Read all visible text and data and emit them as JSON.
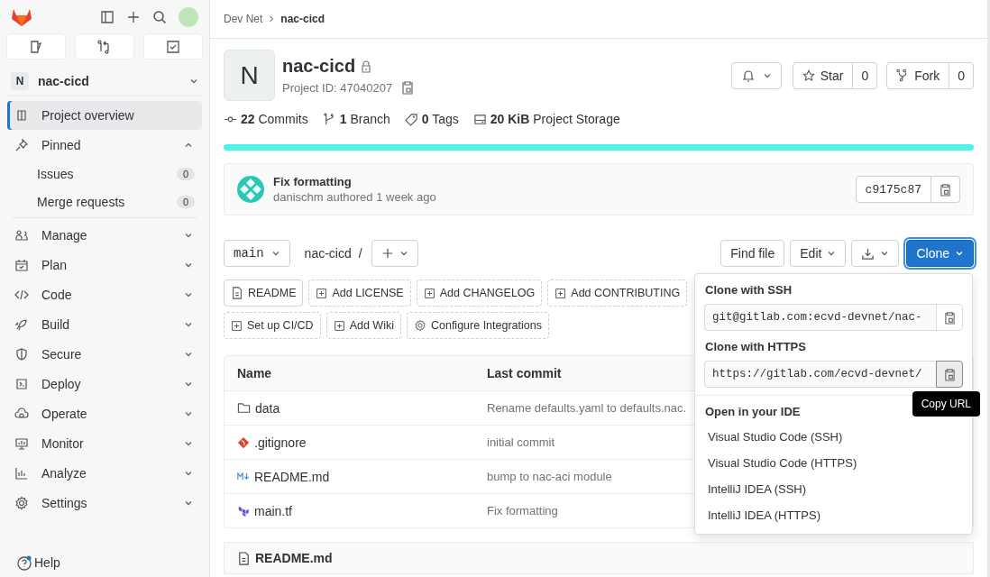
{
  "sidebar": {
    "project": {
      "initial": "N",
      "name": "nac-cicd"
    },
    "items": [
      {
        "label": "Project overview",
        "kind": "link",
        "selected": true
      },
      {
        "label": "Pinned",
        "kind": "section",
        "selected": false,
        "expanded": true,
        "children": [
          {
            "label": "Issues",
            "count": "0"
          },
          {
            "label": "Merge requests",
            "count": "0"
          }
        ]
      },
      {
        "label": "Manage",
        "kind": "section",
        "selected": false,
        "expanded": false
      },
      {
        "label": "Plan",
        "kind": "section",
        "selected": false,
        "expanded": false
      },
      {
        "label": "Code",
        "kind": "section",
        "selected": false,
        "expanded": false
      },
      {
        "label": "Build",
        "kind": "section",
        "selected": false,
        "expanded": false
      },
      {
        "label": "Secure",
        "kind": "section",
        "selected": false,
        "expanded": false
      },
      {
        "label": "Deploy",
        "kind": "section",
        "selected": false,
        "expanded": false
      },
      {
        "label": "Operate",
        "kind": "section",
        "selected": false,
        "expanded": false
      },
      {
        "label": "Monitor",
        "kind": "section",
        "selected": false,
        "expanded": false
      },
      {
        "label": "Analyze",
        "kind": "section",
        "selected": false,
        "expanded": false
      },
      {
        "label": "Settings",
        "kind": "section",
        "selected": false,
        "expanded": false
      }
    ],
    "help": "Help"
  },
  "breadcrumb": [
    "Dev Net",
    "nac-cicd"
  ],
  "project": {
    "initial": "N",
    "name": "nac-cicd",
    "id_label": "Project ID: 47040207",
    "star_label": "Star",
    "star_count": "0",
    "fork_label": "Fork",
    "fork_count": "0"
  },
  "stats": [
    {
      "count": "22",
      "label": "Commits"
    },
    {
      "count": "1",
      "label": "Branch"
    },
    {
      "count": "0",
      "label": "Tags"
    },
    {
      "count": "20 KiB",
      "label": "Project Storage"
    }
  ],
  "languages": [
    {
      "color": "#4ef2e6",
      "level": 1
    }
  ],
  "last_commit": {
    "title": "Fix formatting",
    "meta": "danischm authored 1 week ago",
    "sha": "c9175c87"
  },
  "toolbar": {
    "branch": "main",
    "path": "nac-cicd",
    "separator": "/",
    "find": "Find file",
    "edit": "Edit",
    "clone": "Clone"
  },
  "shortcut_rows": [
    [
      {
        "label": "README",
        "kind": "existing"
      },
      {
        "label": "Add LICENSE",
        "kind": "add"
      },
      {
        "label": "Add CHANGELOG",
        "kind": "add"
      },
      {
        "label": "Add CONTRIBUTING",
        "kind": "add"
      }
    ],
    [
      {
        "label": "Set up CI/CD",
        "kind": "add"
      },
      {
        "label": "Add Wiki",
        "kind": "add"
      },
      {
        "label": "Configure Integrations",
        "kind": "configure"
      }
    ]
  ],
  "table": {
    "columns": [
      "Name",
      "Last commit"
    ],
    "rows": [
      {
        "name": "data",
        "kind": "folder",
        "commit": "Rename defaults.yaml to defaults.nac."
      },
      {
        "name": ".gitignore",
        "kind": "file",
        "commit": "initial commit"
      },
      {
        "name": "README.md",
        "kind": "file",
        "commit": "bump to nac-aci module"
      },
      {
        "name": "main.tf",
        "kind": "file",
        "commit": "Fix formatting"
      }
    ]
  },
  "readme": {
    "title": "README.md"
  },
  "clone_menu": {
    "ssh_title": "Clone with SSH",
    "ssh_url": "git@gitlab.com:ecvd-devnet/nac-",
    "https_title": "Clone with HTTPS",
    "https_url": "https://gitlab.com/ecvd-devnet/",
    "tooltip": "Copy URL",
    "ide_title": "Open in your IDE",
    "ide_items": [
      "Visual Studio Code (SSH)",
      "Visual Studio Code (HTTPS)",
      "IntelliJ IDEA (SSH)",
      "IntelliJ IDEA (HTTPS)"
    ]
  }
}
